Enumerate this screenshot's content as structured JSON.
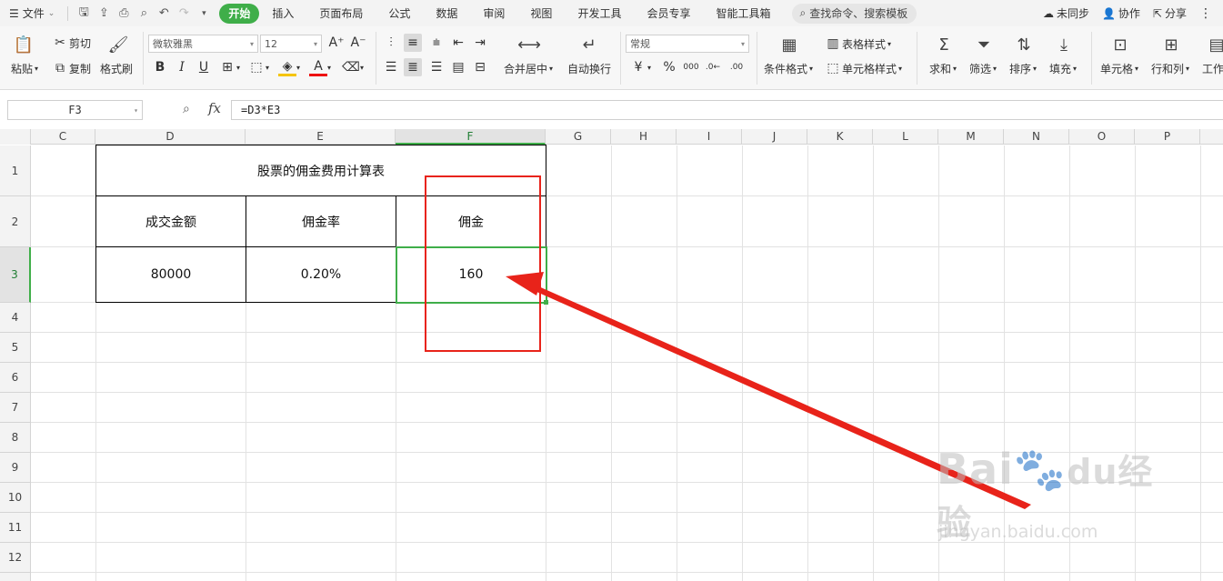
{
  "menubar": {
    "file_label": "文件",
    "tabs": [
      "开始",
      "插入",
      "页面布局",
      "公式",
      "数据",
      "审阅",
      "视图",
      "开发工具",
      "会员专享",
      "智能工具箱"
    ],
    "search_label": "查找命令、搜索模板",
    "right": {
      "sync": "未同步",
      "collab": "协作",
      "share": "分享"
    }
  },
  "ribbon": {
    "paste": "粘贴",
    "cut": "剪切",
    "copy": "复制",
    "format_painter": "格式刷",
    "font_name": "微软雅黑",
    "font_size": "12",
    "merge_center": "合并居中",
    "wrap_text": "自动换行",
    "number_format": "常规",
    "conditional_format": "条件格式",
    "table_style": "表格样式",
    "cell_style": "单元格样式",
    "sum": "求和",
    "filter": "筛选",
    "sort": "排序",
    "fill": "填充",
    "cell": "单元格",
    "row_col": "行和列",
    "worksheet": "工作"
  },
  "formula_bar": {
    "cell_ref": "F3",
    "fx_label": "fx",
    "formula": "=D3*E3"
  },
  "columns": [
    "C",
    "D",
    "E",
    "F",
    "G",
    "H",
    "I",
    "J",
    "K",
    "L",
    "M",
    "N",
    "O",
    "P"
  ],
  "rows": [
    "1",
    "2",
    "3",
    "4",
    "5",
    "6",
    "7",
    "8",
    "9",
    "10",
    "11",
    "12"
  ],
  "selected": {
    "column": "F",
    "row": "3"
  },
  "table": {
    "title": "股票的佣金费用计算表",
    "headers": [
      "成交金额",
      "佣金率",
      "佣金"
    ],
    "values": [
      "80000",
      "0.20%",
      "160"
    ]
  },
  "watermark": {
    "main": "Bai",
    "main_cn": "经验",
    "sub": "jingyan.baidu.com"
  },
  "colors": {
    "accent_green": "#3fae49",
    "annotation_red": "#e8231a"
  }
}
